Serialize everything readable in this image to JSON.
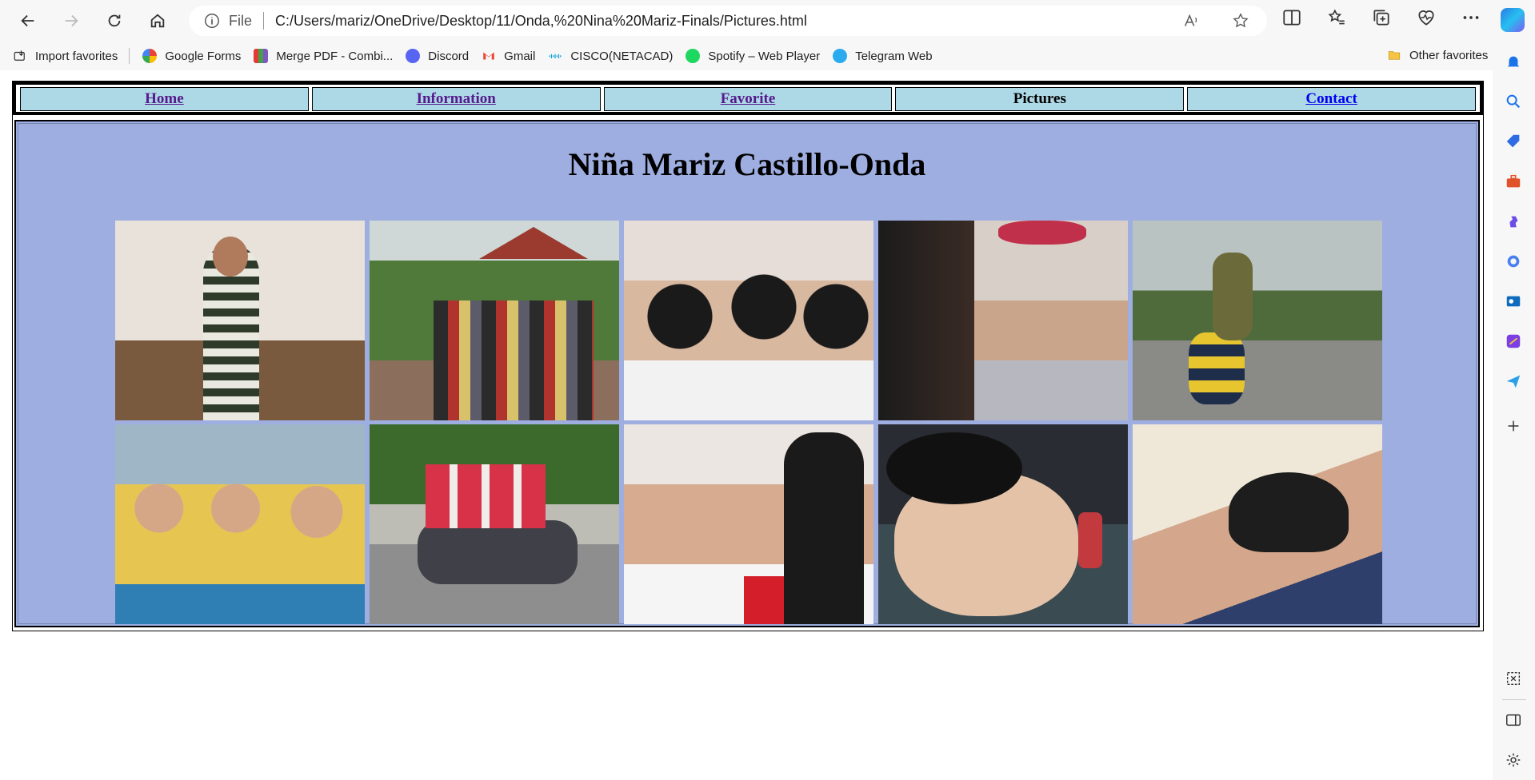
{
  "browser": {
    "address_label": "File",
    "url": "C:/Users/mariz/OneDrive/Desktop/11/Onda,%20Nina%20Mariz-Finals/Pictures.html",
    "favorites": [
      {
        "label": "Import favorites",
        "icon": "import-icon"
      },
      {
        "label": "Google Forms",
        "icon": "google-icon"
      },
      {
        "label": "Merge PDF - Combi...",
        "icon": "pdf-icon"
      },
      {
        "label": "Discord",
        "icon": "discord-icon"
      },
      {
        "label": "Gmail",
        "icon": "gmail-icon"
      },
      {
        "label": "CISCO(NETACAD)",
        "icon": "cisco-icon"
      },
      {
        "label": "Spotify – Web Player",
        "icon": "spotify-icon"
      },
      {
        "label": "Telegram Web",
        "icon": "telegram-icon"
      }
    ],
    "other_favorites": "Other favorites"
  },
  "nav": {
    "items": [
      {
        "label": "Home",
        "visited": true
      },
      {
        "label": "Information",
        "visited": true
      },
      {
        "label": "Favorite",
        "visited": true
      },
      {
        "label": "Pictures",
        "current": true
      },
      {
        "label": "Contact",
        "visited": false
      }
    ]
  },
  "page": {
    "title": "Niña Mariz Castillo-Onda",
    "background_color": "#9eaee0",
    "nav_color": "#add8e6"
  },
  "gallery": {
    "photos": [
      {
        "name": "photo-1",
        "desc": "girl in striped dress"
      },
      {
        "name": "photo-2",
        "desc": "group near gazebo"
      },
      {
        "name": "photo-3",
        "desc": "three girls selfie"
      },
      {
        "name": "photo-4",
        "desc": "two girls with bow"
      },
      {
        "name": "photo-5",
        "desc": "girl in camo shirt"
      },
      {
        "name": "photo-6",
        "desc": "group selfie yellow shirts"
      },
      {
        "name": "photo-7",
        "desc": "girls on motorcycle"
      },
      {
        "name": "photo-8",
        "desc": "three girls smiling"
      },
      {
        "name": "photo-9",
        "desc": "baby photo"
      },
      {
        "name": "photo-10",
        "desc": "two girls selfie"
      }
    ]
  }
}
